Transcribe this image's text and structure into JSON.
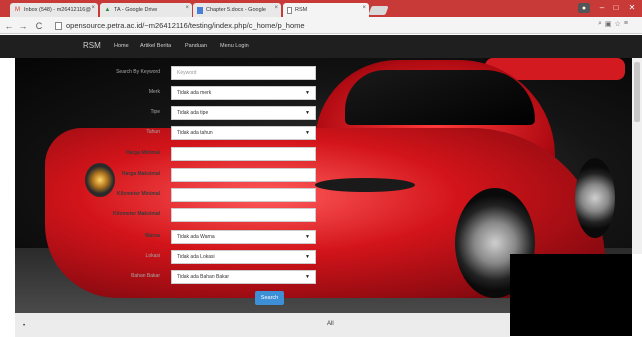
{
  "browser": {
    "tabs": [
      {
        "label": "Inbox (548) - m26412116@",
        "icon": "gmail-icon"
      },
      {
        "label": "TA - Google Drive",
        "icon": "drive-icon"
      },
      {
        "label": "Chapter 5.docx - Google",
        "icon": "docs-icon"
      },
      {
        "label": "RSM",
        "icon": "page-icon",
        "active": true
      }
    ],
    "url": "opensource.petra.ac.id/~m26412116/testing/index.php/c_home/p_home"
  },
  "site": {
    "brand": "RSM",
    "nav": [
      "Home",
      "Artikel Berita",
      "Panduan",
      "Menu Login"
    ]
  },
  "form": {
    "search_keyword": {
      "label": "Search By Keyword",
      "placeholder": "Keyword"
    },
    "merk": {
      "label": "Merk",
      "value": "Tidak ada merk"
    },
    "tipe": {
      "label": "Tipe",
      "value": "Tidak ada tipe"
    },
    "tahun": {
      "label": "Tahun",
      "value": "Tidak ada tahun"
    },
    "harga_min": {
      "label": "Harga Minimal",
      "value": ""
    },
    "harga_max": {
      "label": "Harga Maksimal",
      "value": ""
    },
    "km_min": {
      "label": "Kilometer Minimal",
      "value": ""
    },
    "km_max": {
      "label": "Kilometer Maksimal",
      "value": ""
    },
    "warna": {
      "label": "Warna",
      "value": "Tidak ada Warna"
    },
    "lokasi": {
      "label": "Lokasi",
      "value": "Tidak ada Lokasi"
    },
    "bahan_bakar": {
      "label": "Bahan Bakar",
      "value": "Tidak ada Bahan Bakar"
    },
    "search_button": "Search"
  },
  "footer_bar": {
    "left": "•",
    "center": "All"
  },
  "colors": {
    "tab_strip": "#c73a38",
    "navbar": "#1f1f1f",
    "search_button": "#3d8fd6"
  }
}
